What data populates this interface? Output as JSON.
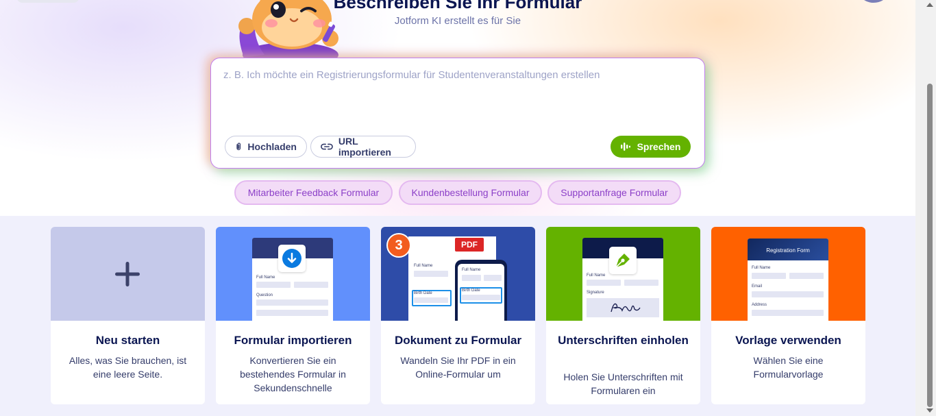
{
  "header": {
    "headline": "Beschreiben Sie Ihr Formular",
    "subtitle": "Jotform KI erstellt es für Sie"
  },
  "prompt": {
    "placeholder": "z. B. Ich möchte ein Registrierungsformular für Studentenveranstaltungen erstellen",
    "value": "",
    "upload_label": "Hochladen",
    "url_label": "URL importieren",
    "speak_label": "Sprechen"
  },
  "suggestions": [
    "Mitarbeiter Feedback Formular",
    "Kundenbestellung Formular",
    "Supportanfrage Formular"
  ],
  "cards": [
    {
      "title": "Neu starten",
      "description": "Alles, was Sie brauchen, ist eine leere Seite.",
      "icon": "plus-icon",
      "color": "#c5c9ea"
    },
    {
      "title": "Formular importieren",
      "description": "Konvertieren Sie ein bestehendes Formular in Sekundenschnelle",
      "icon": "download-icon",
      "color": "#6190fc"
    },
    {
      "title": "Dokument zu Formular",
      "description": "Wandeln Sie Ihr PDF in ein Online-Formular um",
      "icon": "pdf-icon",
      "color": "#2e4ca8"
    },
    {
      "title": "Unterschriften einholen",
      "description": "Holen Sie Unterschriften mit Formularen ein",
      "icon": "pen-nib-icon",
      "color": "#64b200"
    },
    {
      "title": "Vorlage verwenden",
      "description": "Wählen Sie eine Formularvorlage",
      "icon": "template-icon",
      "color": "#ff6100"
    }
  ],
  "illustrations": {
    "full_name": "Full Name",
    "question": "Question",
    "birth_date": "Birth Date",
    "signature": "Signature",
    "email": "Email",
    "address": "Address",
    "registration_form": "Registration Form",
    "pdf_badge": "PDF",
    "step_badge": "3"
  },
  "colors": {
    "primary_text": "#0a1551",
    "accent_green": "#64b200",
    "suggestion_purple": "#8c40c8",
    "pdf_red": "#dc2626",
    "step_orange": "#f25c1e"
  }
}
